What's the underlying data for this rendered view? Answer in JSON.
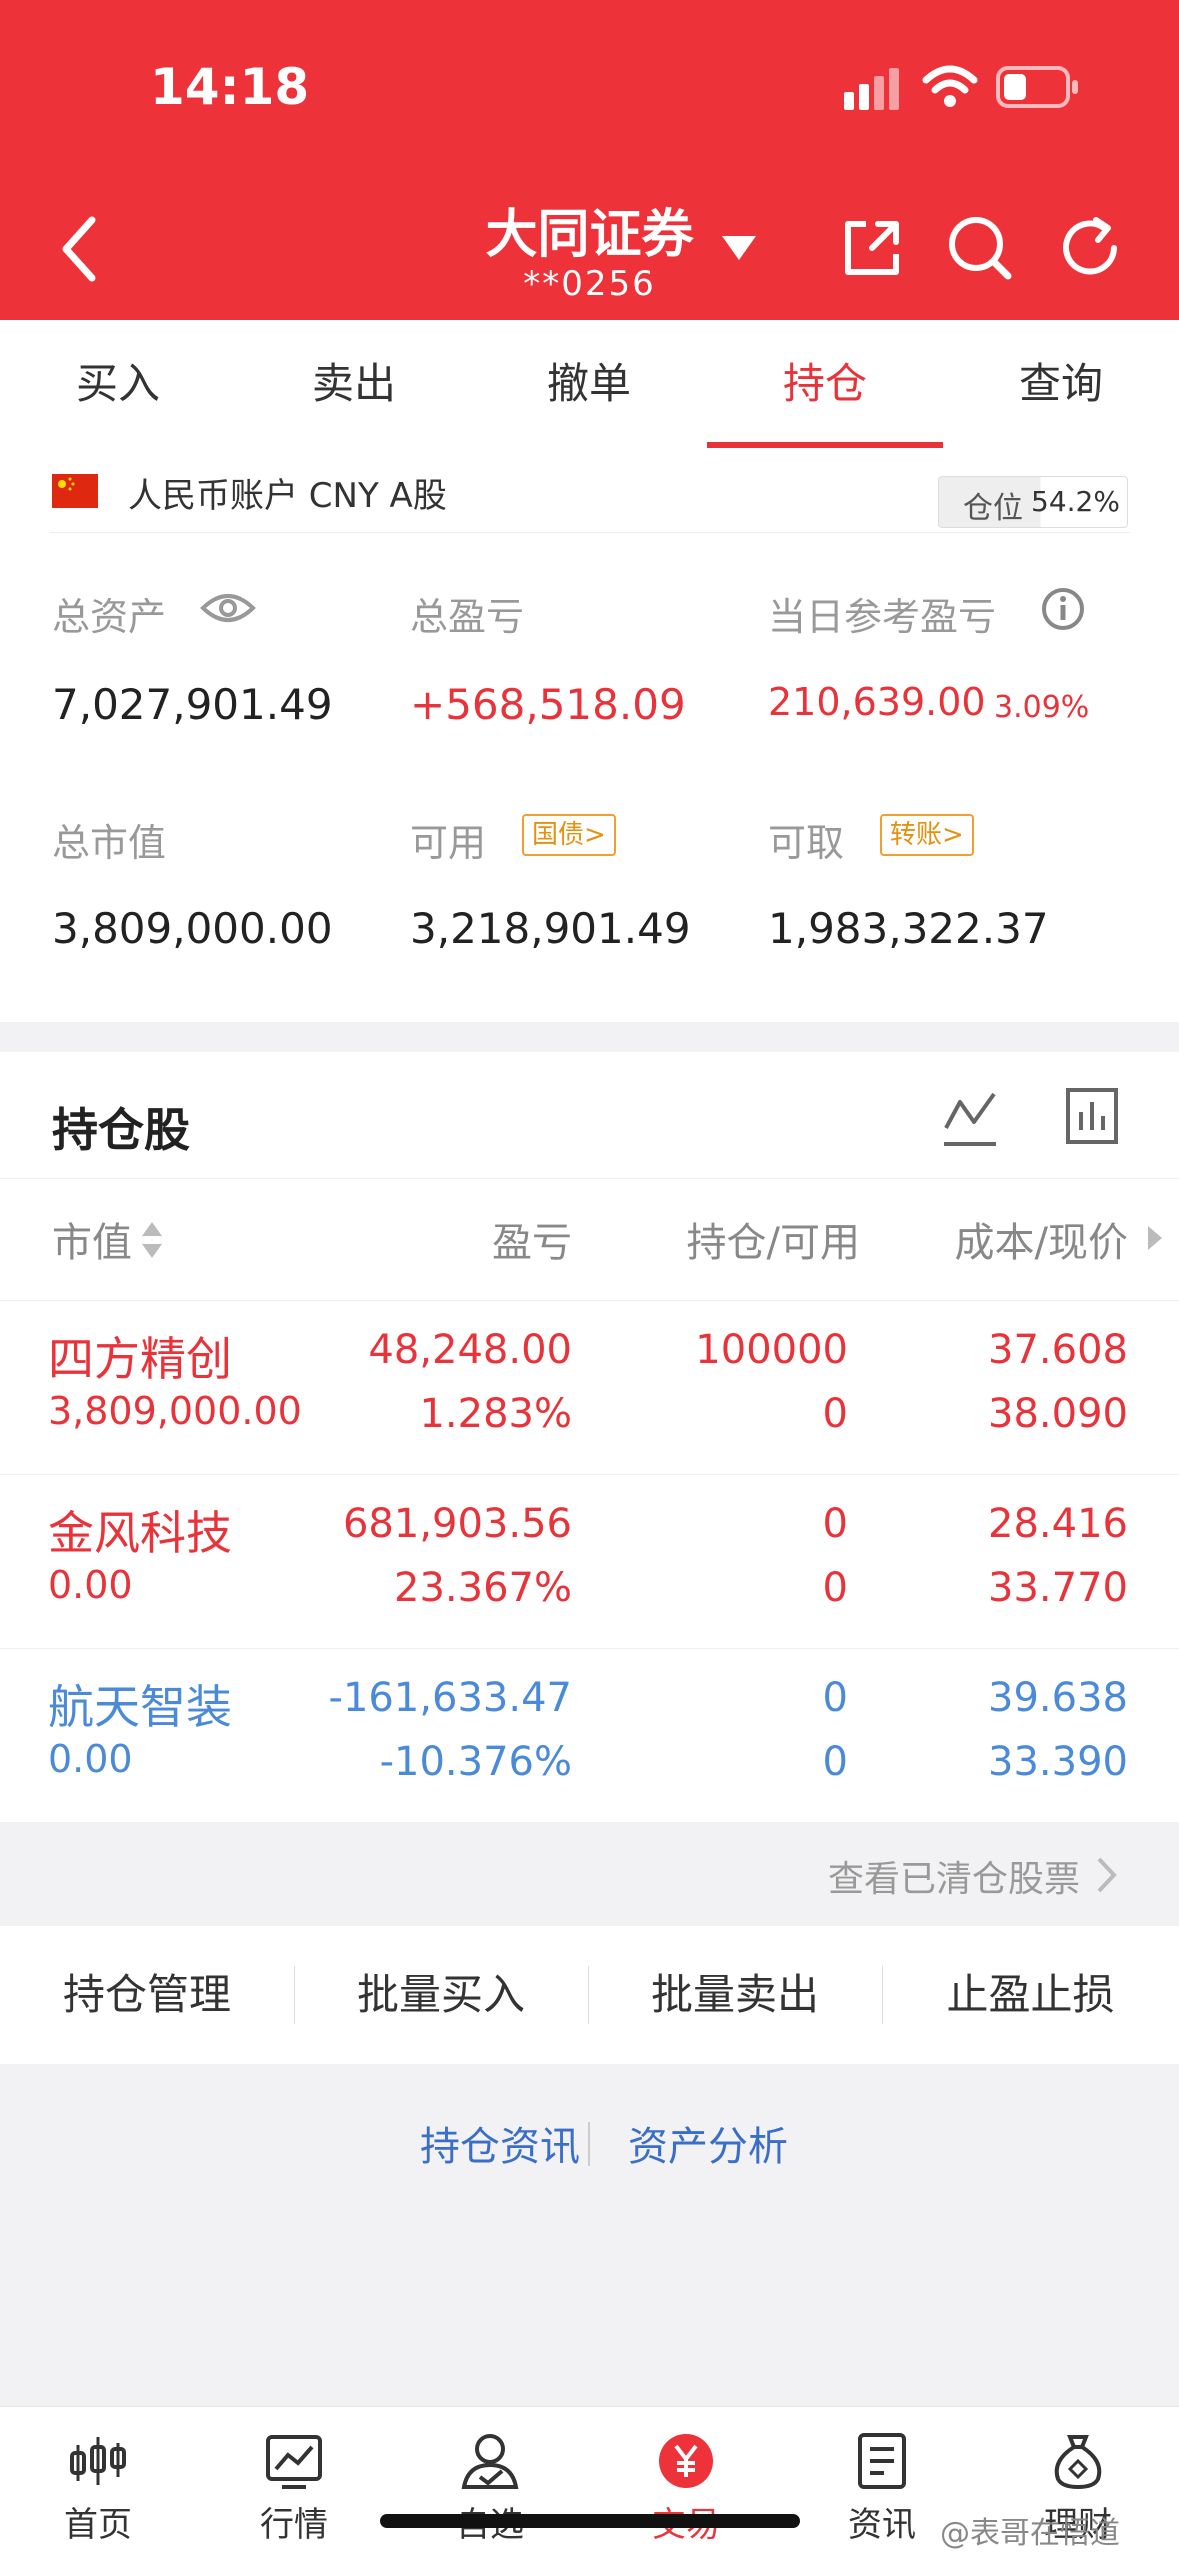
{
  "status": {
    "time": "14:18"
  },
  "header": {
    "title": "大同证券",
    "account": "**0256"
  },
  "tabs": [
    "买入",
    "卖出",
    "撤单",
    "持仓",
    "查询"
  ],
  "account": {
    "currency_label": "人民币账户 CNY A股",
    "position_label": "仓位",
    "position_value": "54.2%",
    "total_assets_label": "总资产",
    "total_assets": "7,027,901.49",
    "total_pl_label": "总盈亏",
    "total_pl": "+568,518.09",
    "daily_pl_label": "当日参考盈亏",
    "daily_pl": "210,639.00",
    "daily_pl_pct": "3.09%",
    "market_value_label": "总市值",
    "market_value": "3,809,000.00",
    "available_label": "可用",
    "available_badge": "国债>",
    "available": "3,218,901.49",
    "withdrawable_label": "可取",
    "withdrawable_badge": "转账>",
    "withdrawable": "1,983,322.37"
  },
  "holdings": {
    "title": "持仓股",
    "headers": {
      "market_value": "市值",
      "pl": "盈亏",
      "qty": "持仓/可用",
      "cost": "成本/现价"
    },
    "rows": [
      {
        "name": "四方精创",
        "market_value": "3,809,000.00",
        "pl": "48,248.00",
        "pl_pct": "1.283%",
        "qty": "100000",
        "avail": "0",
        "cost": "37.608",
        "price": "38.090",
        "color": "#e8333a"
      },
      {
        "name": "金风科技",
        "market_value": "0.00",
        "pl": "681,903.56",
        "pl_pct": "23.367%",
        "qty": "0",
        "avail": "0",
        "cost": "28.416",
        "price": "33.770",
        "color": "#e8333a"
      },
      {
        "name": "航天智装",
        "market_value": "0.00",
        "pl": "-161,633.47",
        "pl_pct": "-10.376%",
        "qty": "0",
        "avail": "0",
        "cost": "39.638",
        "price": "33.390",
        "color": "#4a8ad8"
      }
    ],
    "cleared_link": "查看已清仓股票"
  },
  "actions": [
    "持仓管理",
    "批量买入",
    "批量卖出",
    "止盈止损"
  ],
  "links": [
    "持仓资讯",
    "资产分析"
  ],
  "tabbar": [
    {
      "label": "首页",
      "icon": "candlestick-icon"
    },
    {
      "label": "行情",
      "icon": "chart-icon"
    },
    {
      "label": "自选",
      "icon": "user-check-icon"
    },
    {
      "label": "交易",
      "icon": "yuan-icon"
    },
    {
      "label": "资讯",
      "icon": "document-icon"
    },
    {
      "label": "理财",
      "icon": "money-bag-icon"
    }
  ],
  "watermark": "@表哥在悟道",
  "colors": {
    "brand_red": "#ee3239",
    "loss_blue": "#4a8ad8",
    "badge_orange": "#f0a030"
  }
}
